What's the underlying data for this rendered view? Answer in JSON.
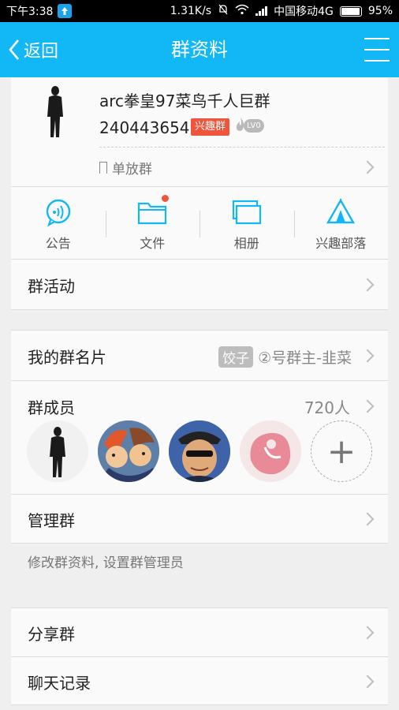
{
  "status_bar": {
    "time": "下午3:38",
    "net_speed": "1.31K/s",
    "carrier": "中国移动4G",
    "battery": "95%",
    "battery_level": 0.95
  },
  "title_bar": {
    "back_label": "返回",
    "title": "群资料"
  },
  "group": {
    "name": "arc拳皇97菜鸟千人巨群",
    "id": "240443654",
    "category_tag": "兴趣群",
    "level": "LV0",
    "tag_label": "单放群"
  },
  "shortcuts": [
    {
      "label": "公告",
      "icon": "announcement-icon"
    },
    {
      "label": "文件",
      "icon": "folder-icon"
    },
    {
      "label": "相册",
      "icon": "album-icon"
    },
    {
      "label": "兴趣部落",
      "icon": "tribe-icon"
    }
  ],
  "rows": {
    "activity": "群活动",
    "nickname_label": "我的群名片",
    "nickname_chip": "饺子",
    "nickname_value": "②号群主-韭菜",
    "members_label": "群成员",
    "members_count": "720人",
    "manage": "管理群",
    "manage_desc": "修改群资料, 设置群管理员",
    "share": "分享群",
    "chat_history": "聊天记录"
  },
  "colors": {
    "accent": "#12b7f5",
    "tag_red": "#f0553c"
  }
}
